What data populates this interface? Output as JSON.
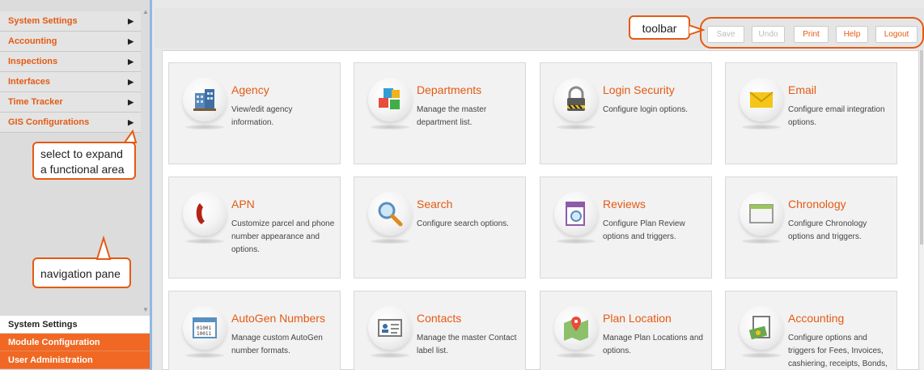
{
  "nav": {
    "items": [
      {
        "label": "System Settings"
      },
      {
        "label": "Accounting"
      },
      {
        "label": "Inspections"
      },
      {
        "label": "Interfaces"
      },
      {
        "label": "Time Tracker"
      },
      {
        "label": "GIS Configurations"
      }
    ],
    "bottom": [
      {
        "label": "System Settings"
      },
      {
        "label": "Module Configuration"
      },
      {
        "label": "User Administration"
      }
    ]
  },
  "callouts": {
    "expand": "select to expand a functional area",
    "nav": "navigation pane",
    "toolbar": "toolbar"
  },
  "toolbar": {
    "save": "Save",
    "undo": "Undo",
    "print": "Print",
    "help": "Help",
    "logout": "Logout"
  },
  "cards": [
    {
      "title": "Agency",
      "desc": "View/edit agency information.",
      "icon": "building-icon"
    },
    {
      "title": "Departments",
      "desc": "Manage the master department list.",
      "icon": "cubes-icon"
    },
    {
      "title": "Login Security",
      "desc": "Configure login options.",
      "icon": "padlock-icon"
    },
    {
      "title": "Email",
      "desc": "Configure email integration options.",
      "icon": "envelope-icon"
    },
    {
      "title": "APN",
      "desc": "Customize parcel and phone number appearance and options.",
      "icon": "phone-icon"
    },
    {
      "title": "Search",
      "desc": "Configure search options.",
      "icon": "magnifier-icon"
    },
    {
      "title": "Reviews",
      "desc": "Configure Plan Review options and triggers.",
      "icon": "review-document-icon"
    },
    {
      "title": "Chronology",
      "desc": "Configure Chronology options and triggers.",
      "icon": "window-icon"
    },
    {
      "title": "AutoGen Numbers",
      "desc": "Manage custom AutoGen number formats.",
      "icon": "binary-numbers-icon"
    },
    {
      "title": "Contacts",
      "desc": "Manage the master Contact label list.",
      "icon": "contact-card-icon"
    },
    {
      "title": "Plan Location",
      "desc": "Manage Plan Locations and options.",
      "icon": "map-pin-icon"
    },
    {
      "title": "Accounting",
      "desc": "Configure options and triggers for Fees, Invoices, cashiering, receipts, Bonds,",
      "icon": "money-notepad-icon"
    }
  ],
  "colors": {
    "accent": "#e55a12",
    "nav_orange": "#f06823",
    "nav_border": "#8fb8e3"
  }
}
